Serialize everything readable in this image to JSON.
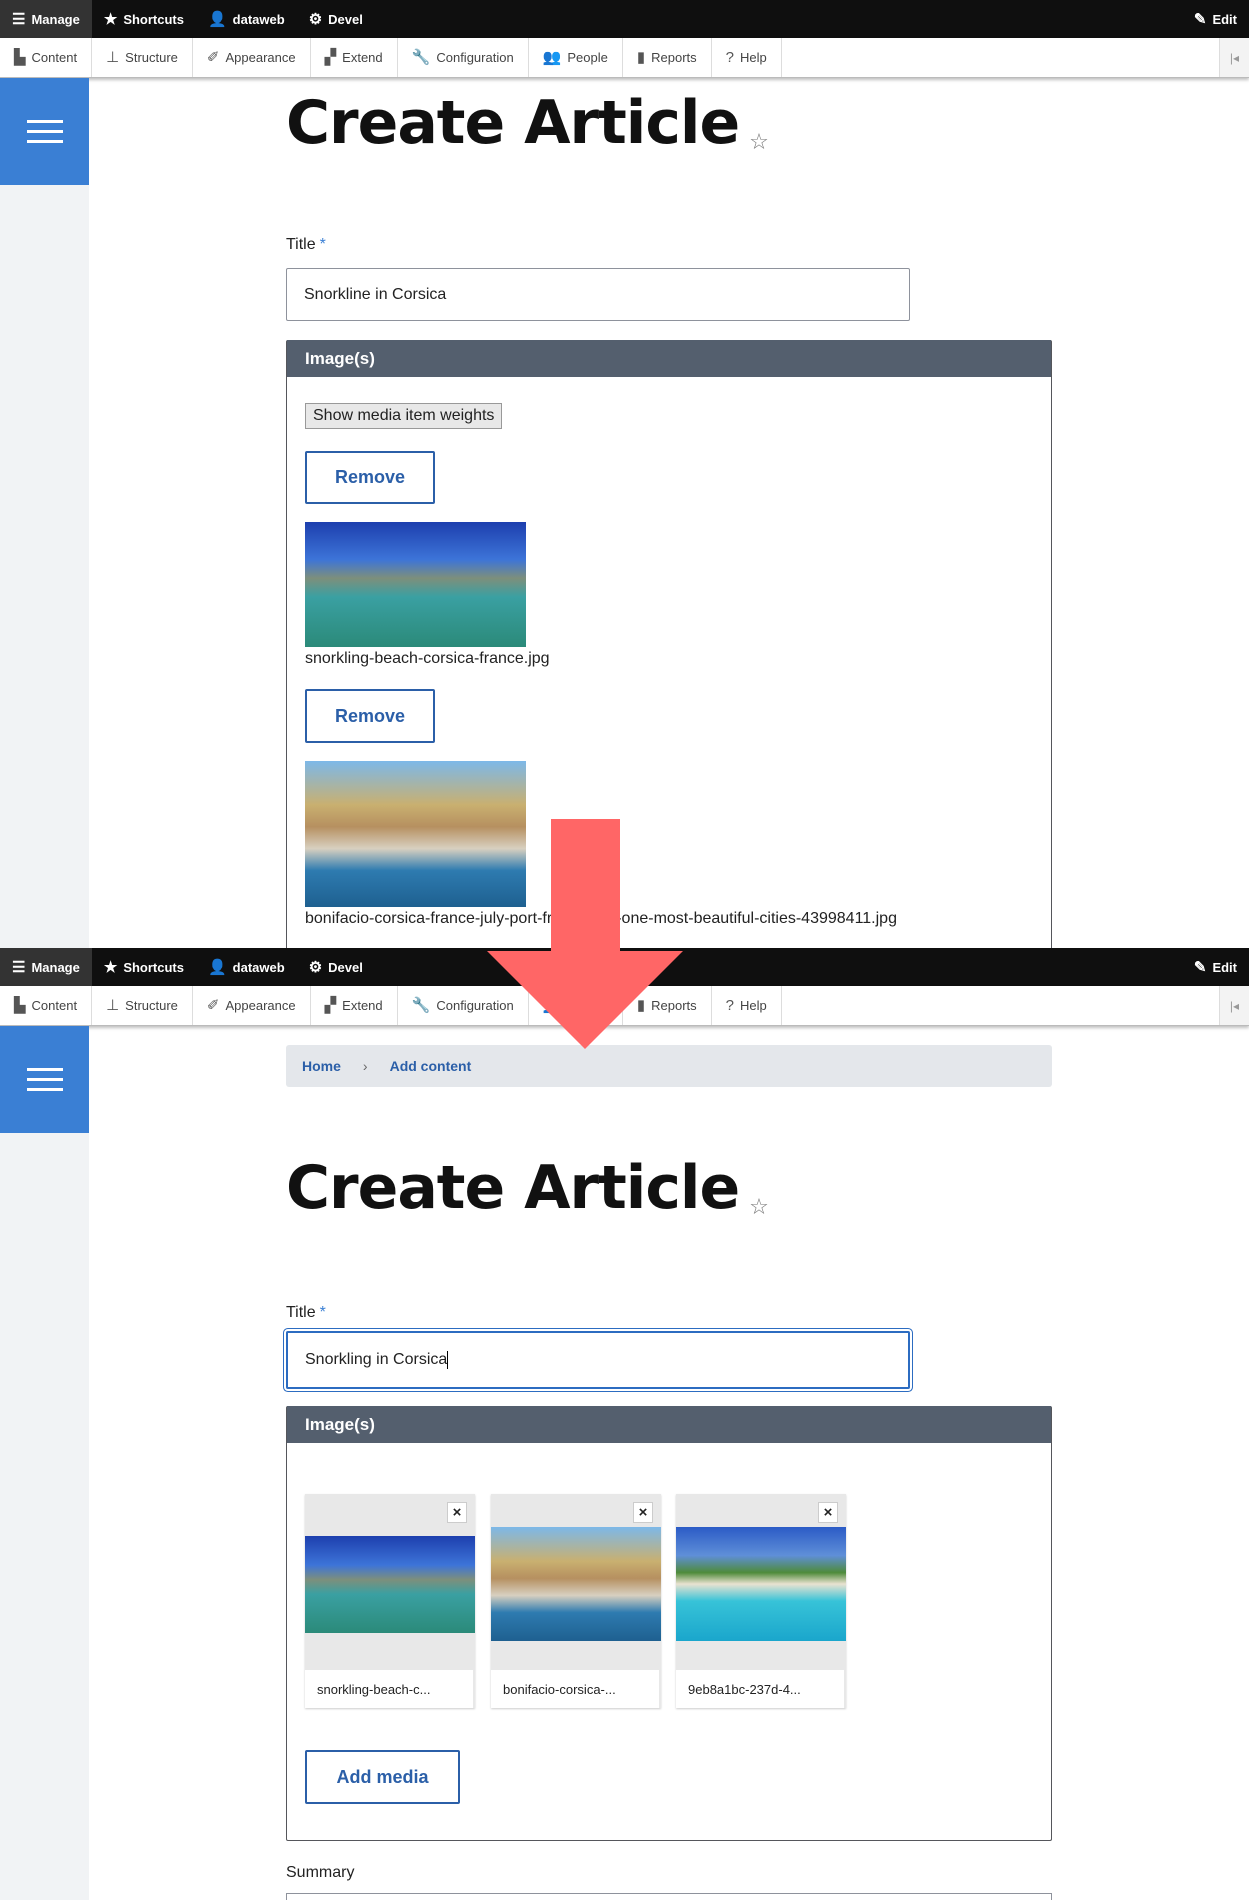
{
  "toolbar": {
    "manage": "Manage",
    "shortcuts": "Shortcuts",
    "user": "dataweb",
    "devel": "Devel",
    "edit": "Edit"
  },
  "tray": [
    "Content",
    "Structure",
    "Appearance",
    "Extend",
    "Configuration",
    "People",
    "Reports",
    "Help"
  ],
  "before": {
    "page_title": "Create Article",
    "title_label": "Title",
    "required_mark": "*",
    "title_value": "Snorkline in Corsica",
    "fieldset_legend": "Image(s)",
    "show_weights": "Show media item weights",
    "remove": "Remove",
    "files": [
      "snorkling-beach-corsica-france.jpg",
      "bonifacio-corsica-france-july-port-france-july-one-most-beautiful-cities-43998411.jpg"
    ]
  },
  "after": {
    "breadcrumb": [
      "Home",
      "Add content"
    ],
    "page_title": "Create Article",
    "title_label": "Title",
    "required_mark": "*",
    "title_value": "Snorkling in Corsica",
    "fieldset_legend": "Image(s)",
    "remove_icon": "×",
    "media": [
      "snorkling-beach-c...",
      "bonifacio-corsica-...",
      "9eb8a1bc-237d-4..."
    ],
    "add_media": "Add media",
    "summary_label": "Summary"
  },
  "colors": {
    "accent": "#2b5fa8",
    "arrow": "#ff6666",
    "legend": "#545f6e"
  }
}
